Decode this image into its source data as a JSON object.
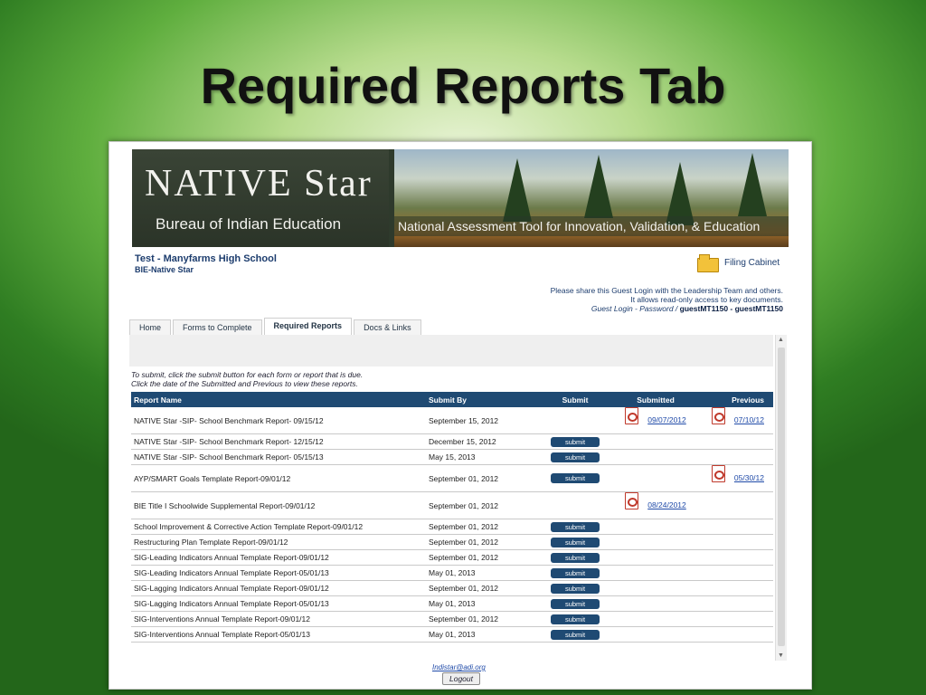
{
  "slide": {
    "title": "Required Reports Tab"
  },
  "banner": {
    "logo": "NATIVE Star",
    "subtitle": "Bureau of Indian Education",
    "tagline": "National Assessment Tool for Innovation, Validation, & Education"
  },
  "header": {
    "school": "Test - Manyfarms High School",
    "org": "BIE-Native Star",
    "filing_cabinet": "Filing Cabinet",
    "guest_line1": "Please share this Guest Login with the Leadership Team and others.",
    "guest_line2": "It allows read-only access to key documents.",
    "guest_label": "Guest Login - Password /",
    "guest_creds": "guestMT1150 - guestMT1150"
  },
  "tabs": [
    "Home",
    "Forms to Complete",
    "Required Reports",
    "Docs & Links"
  ],
  "instructions": {
    "line1": "To submit, click the submit button for each form or report that is due.",
    "line2": "Click the date of the Submitted and Previous to view these reports."
  },
  "table": {
    "headers": [
      "Report Name",
      "Submit By",
      "Submit",
      "Submitted",
      "Previous"
    ],
    "submit_label": "submit",
    "rows": [
      {
        "name": "NATIVE Star -SIP- School Benchmark Report- 09/15/12",
        "due": "September 15, 2012",
        "submit": false,
        "submitted": "09/07/2012",
        "previous": "07/10/12"
      },
      {
        "name": "NATIVE Star -SIP- School Benchmark Report- 12/15/12",
        "due": "December 15, 2012",
        "submit": true,
        "submitted": "",
        "previous": ""
      },
      {
        "name": "NATIVE Star -SIP- School Benchmark Report- 05/15/13",
        "due": "May 15, 2013",
        "submit": true,
        "submitted": "",
        "previous": ""
      },
      {
        "name": "AYP/SMART Goals Template Report-09/01/12",
        "due": "September 01, 2012",
        "submit": true,
        "submitted": "",
        "previous": "05/30/12"
      },
      {
        "name": "BIE Title I Schoolwide Supplemental Report-09/01/12",
        "due": "September 01, 2012",
        "submit": false,
        "submitted": "08/24/2012",
        "previous": ""
      },
      {
        "name": "School Improvement & Corrective Action Template Report-09/01/12",
        "due": "September 01, 2012",
        "submit": true,
        "submitted": "",
        "previous": ""
      },
      {
        "name": "Restructuring Plan Template Report-09/01/12",
        "due": "September 01, 2012",
        "submit": true,
        "submitted": "",
        "previous": ""
      },
      {
        "name": "SIG-Leading Indicators Annual Template Report-09/01/12",
        "due": "September 01, 2012",
        "submit": true,
        "submitted": "",
        "previous": ""
      },
      {
        "name": "SIG-Leading Indicators Annual Template Report-05/01/13",
        "due": "May 01, 2013",
        "submit": true,
        "submitted": "",
        "previous": ""
      },
      {
        "name": "SIG-Lagging Indicators Annual Template Report-09/01/12",
        "due": "September 01, 2012",
        "submit": true,
        "submitted": "",
        "previous": ""
      },
      {
        "name": "SIG-Lagging Indicators Annual Template Report-05/01/13",
        "due": "May 01, 2013",
        "submit": true,
        "submitted": "",
        "previous": ""
      },
      {
        "name": "SIG-Interventions Annual Template Report-09/01/12",
        "due": "September 01, 2012",
        "submit": true,
        "submitted": "",
        "previous": ""
      },
      {
        "name": "SIG-Interventions Annual Template Report-05/01/13",
        "due": "May 01, 2013",
        "submit": true,
        "submitted": "",
        "previous": ""
      }
    ]
  },
  "footer": {
    "email": "Indistar@adi.org",
    "logout": "Logout"
  }
}
